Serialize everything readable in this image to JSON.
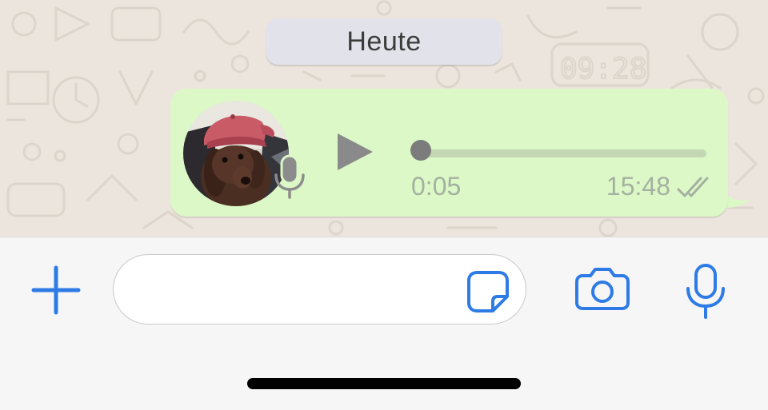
{
  "chat": {
    "date_label": "Heute"
  },
  "voice_message": {
    "duration": "0:05",
    "sent_time": "15:48",
    "status_icon": "double-check-icon",
    "progress": 0.0,
    "avatar_description": "dog-in-red-cap-photo",
    "badge_icon": "microphone-icon"
  },
  "input_bar": {
    "add_icon": "plus-icon",
    "message_value": "",
    "message_placeholder": "",
    "sticker_icon": "sticker-icon",
    "camera_icon": "camera-icon",
    "mic_icon": "microphone-icon"
  },
  "colors": {
    "accent": "#2f7be6",
    "bubble": "#dcf8c6",
    "wallpaper": "#ece5dd",
    "meta_text": "#a4b0a0"
  }
}
